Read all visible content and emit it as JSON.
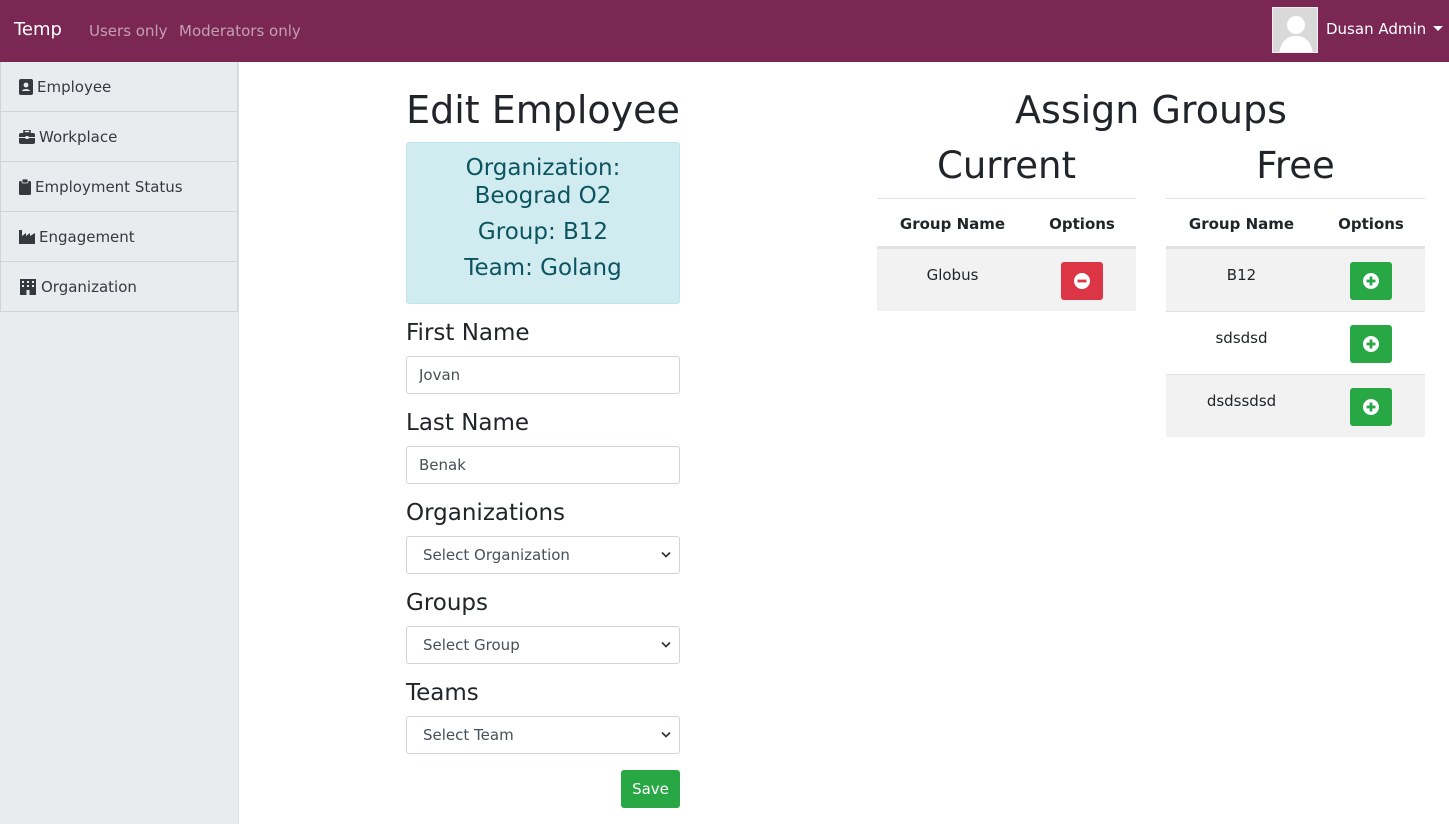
{
  "navbar": {
    "brand": "Temp",
    "links": [
      "Users only",
      "Moderators only"
    ],
    "user_name": "Dusan Admin"
  },
  "sidebar": {
    "items": [
      {
        "label": "Employee",
        "icon": "id-card-icon"
      },
      {
        "label": "Workplace",
        "icon": "briefcase-icon"
      },
      {
        "label": "Employment Status",
        "icon": "clipboard-icon"
      },
      {
        "label": "Engagement",
        "icon": "industry-icon"
      },
      {
        "label": "Organization",
        "icon": "building-icon"
      }
    ]
  },
  "edit": {
    "title": "Edit Employee",
    "info": {
      "organization_line1": "Organization:",
      "organization_line2": "Beograd O2",
      "group": "Group: B12",
      "team": "Team: Golang"
    },
    "first_name_label": "First Name",
    "first_name_value": "Jovan",
    "last_name_label": "Last Name",
    "last_name_value": "Benak",
    "organizations_label": "Organizations",
    "organizations_selected": "Select Organization",
    "groups_label": "Groups",
    "groups_selected": "Select Group",
    "teams_label": "Teams",
    "teams_selected": "Select Team",
    "save_label": "Save"
  },
  "assign": {
    "title": "Assign Groups",
    "current": {
      "title": "Current",
      "headers": [
        "Group Name",
        "Options"
      ],
      "rows": [
        {
          "name": "Globus",
          "action": "remove"
        }
      ]
    },
    "free": {
      "title": "Free",
      "headers": [
        "Group Name",
        "Options"
      ],
      "rows": [
        {
          "name": "B12",
          "action": "add"
        },
        {
          "name": "sdsdsd",
          "action": "add"
        },
        {
          "name": "dsdssdsd",
          "action": "add"
        }
      ]
    }
  },
  "colors": {
    "navbar": "#7a2853",
    "info_bg": "#d1ecf1",
    "info_text": "#0c5460",
    "success": "#28a745",
    "danger": "#dc3545"
  }
}
